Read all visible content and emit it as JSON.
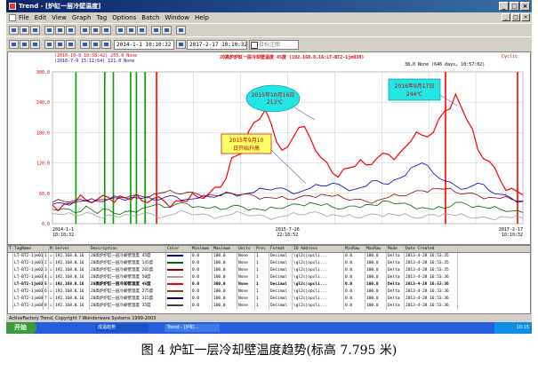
{
  "window": {
    "title": "Trend - [炉缸一层冷壁温度]",
    "close": "×",
    "minimize": "_",
    "maximize": "□"
  },
  "menu": [
    "File",
    "Edit",
    "View",
    "Graph",
    "Tag",
    "Options",
    "Batch",
    "Window",
    "Help"
  ],
  "toolbar": {
    "start_time": "2014-1-1  10:10:32",
    "end_time": "2017-2-17  10:10:32",
    "checkbox_label": "日标注图"
  },
  "chart_header": {
    "title_line": "20高炉炉缸一层冷却壁温度 45度  (192.168.0.16:LT-BT2-1jm038)",
    "cursor1": "(2016-10-8 10:58:42)  255.0 None",
    "cursor2": "(2016-7-9 15:11:54)  121.0 None",
    "right_value": "38.0 None (646 days, 10:57:02)",
    "cyclic": "Cyclic"
  },
  "chart_data": {
    "type": "line",
    "title": "20高炉炉缸一层冷却壁温度 45度",
    "ylim": [
      0,
      300
    ],
    "yticks": [
      "300.0",
      "240.0",
      "180.0",
      "120.0",
      "60.0",
      "0.0"
    ],
    "xticks": [
      {
        "date": "2014-1-1",
        "time": "10:10:32"
      },
      {
        "date": "2015-7-26",
        "time": "22:10:52"
      },
      {
        "date": "2017-2-17",
        "time": "10:10:32"
      }
    ],
    "grid": true,
    "series": [
      {
        "color": "#ff0000",
        "values": [
          37,
          38,
          42,
          47,
          48,
          52,
          55,
          47,
          45,
          50,
          44,
          45,
          44,
          52,
          60,
          72,
          130,
          140,
          200,
          225,
          162,
          152,
          190,
          170,
          130,
          100,
          108,
          113,
          116,
          130,
          137,
          140,
          163,
          175,
          180,
          222,
          256,
          205,
          145,
          123,
          85,
          70,
          57
        ]
      },
      {
        "color": "#0000c0",
        "values": [
          38,
          40,
          43,
          45,
          44,
          48,
          50,
          52,
          50,
          47,
          52,
          54,
          48,
          50,
          53,
          57,
          60,
          58,
          62,
          68,
          70,
          66,
          62,
          70,
          75,
          80,
          72,
          68,
          74,
          85,
          78,
          90,
          110,
          120,
          100,
          85,
          75,
          70,
          80,
          65,
          58,
          50,
          44
        ]
      },
      {
        "color": "#006400",
        "values": [
          28,
          30,
          22,
          35,
          20,
          28,
          18,
          25,
          30,
          36,
          32,
          38,
          40,
          34,
          30,
          28,
          35,
          33,
          30,
          26,
          30,
          35,
          38,
          42,
          36,
          33,
          30,
          35,
          38,
          36,
          44,
          40,
          36,
          32,
          28,
          30,
          42,
          38,
          35,
          30,
          28,
          25,
          22
        ]
      },
      {
        "color": "#8b0000",
        "values": [
          42,
          44,
          46,
          45,
          47,
          48,
          52,
          55,
          54,
          58,
          62,
          60,
          62,
          58,
          57,
          55,
          60,
          58,
          55,
          52,
          50,
          48,
          52,
          55,
          58,
          54,
          50,
          48,
          44,
          46,
          52,
          55,
          60,
          65,
          70,
          68,
          62,
          60,
          56,
          52,
          50,
          48,
          45
        ]
      },
      {
        "color": "#a0a0a0",
        "values": [
          20,
          18,
          16,
          22,
          14,
          18,
          12,
          16,
          20,
          18,
          14,
          20,
          22,
          18,
          16,
          14,
          18,
          20,
          16,
          14,
          12,
          16,
          18,
          22,
          20,
          18,
          14,
          12,
          16,
          18,
          20,
          16,
          14,
          12,
          18,
          20,
          16,
          14,
          12,
          10,
          14,
          12,
          10
        ]
      }
    ],
    "markers": [
      {
        "date": "2014-2-27",
        "color": "#00a000"
      },
      {
        "date": "2014-5-8",
        "color": "#00a000"
      },
      {
        "date": "2014-5-29",
        "color": "#00a000"
      },
      {
        "date": "2014-7-10",
        "color": "#00a000"
      },
      {
        "date": "2014-7-24",
        "color": "#00a000"
      },
      {
        "date": "2014-8-14",
        "color": "#00a000"
      },
      {
        "date": "2014-9-11",
        "color": "#ff0000"
      },
      {
        "date": "2016-8-13",
        "color": "#ff0000"
      },
      {
        "date": "2017-2-4",
        "color": "#ff0000"
      }
    ],
    "annotations": [
      {
        "text": "2015年10月16日    213℃",
        "style": "cyan-ellipse"
      },
      {
        "text": "2016年9月17日    244℃",
        "style": "cyan-rect"
      },
      {
        "text": "2015年9月10日开始升高",
        "style": "red-box"
      }
    ]
  },
  "table": {
    "headers": [
      "T",
      "TagName",
      "",
      "M",
      "Server",
      "Description",
      "Color",
      "Minimum",
      "Maximum",
      "Units",
      "Prec",
      "Format",
      "IO Address",
      "MinRaw",
      "MaxRaw",
      "Mode",
      "Date Created"
    ],
    "rows": [
      [
        "LT-BT2-1jm018",
        "1",
        "192.168.0.16",
        "20高炉炉缸一层冷却壁温度 45度",
        "#0000c0",
        "0.0",
        "100.0",
        "None",
        "1",
        "Decimal",
        "\\gl2c|opcli...",
        "0.0",
        "100.0",
        "Delta",
        "2013-4-28 16:53:35"
      ],
      [
        "LT-BT2-1jm019",
        "2",
        "192.168.0.16",
        "20高炉炉缸一层冷却壁温度 145度",
        "#006400",
        "0.0",
        "100.0",
        "None",
        "1",
        "Decimal",
        "\\gl2c|opcli...",
        "0.0",
        "100.0",
        "Delta",
        "2013-4-28 16:53:35"
      ],
      [
        "LT-BT2-1jm025",
        "3",
        "192.168.0.16",
        "20高炉炉缸一层冷却壁温度 265度",
        "#8b0000",
        "0.0",
        "100.0",
        "None",
        "1",
        "Decimal",
        "\\gl2c|opcli...",
        "0.0",
        "100.0",
        "Delta",
        "2013-4-28 16:53:35"
      ],
      [
        "LT-BT2-1jm031",
        "4",
        "192.168.0.16",
        "20高炉炉缸一层冷却壁温度 50度",
        "#a0a0a0",
        "0.0",
        "100.0",
        "None",
        "1",
        "Decimal",
        "\\gl2c|opcli...",
        "0.0",
        "100.0",
        "Delta",
        "2013-4-28 16:53:36"
      ],
      [
        "LT-BT2-1jm038",
        "5",
        "192.168.0.16",
        "20高炉炉缸一层冷却壁温度 45度",
        "#ff0000",
        "0.0",
        "300.0",
        "None",
        "1",
        "Decimal",
        "\\gl2c|opcli...",
        "0.0",
        "100.0",
        "Delta",
        "2013-4-28 16:53:36"
      ],
      [
        "LT-BT2-1jm039",
        "6",
        "192.168.0.16",
        "20高炉炉缸一层冷却壁温度 275度",
        "#8b4513",
        "0.0",
        "100.0",
        "None",
        "1",
        "Decimal",
        "\\gl2c|opcli...",
        "0.0",
        "100.0",
        "Delta",
        "2013-4-28 16:53:36"
      ],
      [
        "LT-BT2-1jm040",
        "7",
        "192.168.0.16",
        "20高炉炉缸一层冷却壁温度 315度",
        "#000080",
        "0.0",
        "100.0",
        "None",
        "1",
        "Decimal",
        "\\gl2c|opcli...",
        "0.0",
        "100.0",
        "Delta",
        "2013-4-28 16:53:36"
      ],
      [
        "LT-BT2-1jm041",
        "8",
        "192.168.0.16",
        "20高炉炉缸一层冷却壁温度 35度",
        "#404040",
        "0.0",
        "100.0",
        "None",
        "1",
        "Decimal",
        "\\gl2c|opcli...",
        "0.0",
        "100.0",
        "Delta",
        "2013-4-28 16:53:36"
      ]
    ]
  },
  "status": "ActiveFactory Trend, Copyright ? Wonderware Systems 1999-2003",
  "taskbar": {
    "start": "开始",
    "tasks": [
      "Trend - [炉缸...",
      "成温趋势"
    ],
    "clock": "10:15"
  },
  "caption": "图 4  炉缸一层冷却壁温度趋势(标高 7.795 米)"
}
